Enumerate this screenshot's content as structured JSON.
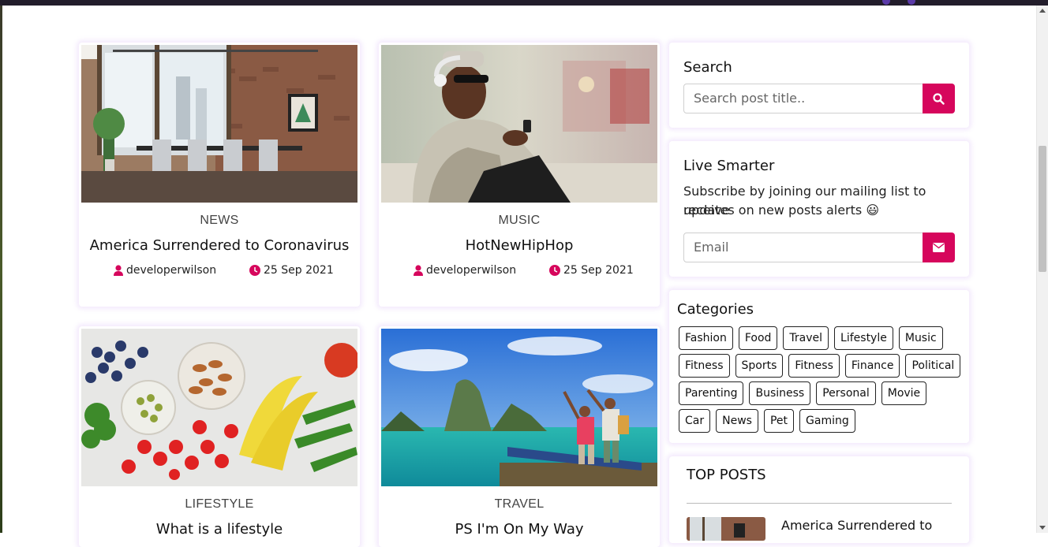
{
  "colors": {
    "accent": "#d6065c",
    "shadow": "#c8a0f0"
  },
  "posts": [
    {
      "category": "NEWS",
      "title": "America Surrendered to Coronavirus",
      "author": "developerwilson",
      "date": "25 Sep 2021",
      "image": "dining-room"
    },
    {
      "category": "MUSIC",
      "title": "HotNewHipHop",
      "author": "developerwilson",
      "date": "25 Sep 2021",
      "image": "man-with-headphones"
    },
    {
      "category": "LIFESTYLE",
      "title": "What is a lifestyle",
      "image": "fruits-and-vegetables"
    },
    {
      "category": "TRAVEL",
      "title": "PS I'm On My Way",
      "image": "tropical-beach-travelers"
    }
  ],
  "search": {
    "title": "Search",
    "placeholder": "Search post title..",
    "icon": "search-icon"
  },
  "newsletter": {
    "title": "Live Smarter",
    "text_line1": "Subscribe by joining our mailing list to receive",
    "text_line2": "updates on new posts alerts 😃",
    "placeholder": "Email",
    "icon": "envelope-icon"
  },
  "categories": {
    "title": "Categories",
    "items": [
      "Fashion",
      "Food",
      "Travel",
      "Lifestyle",
      "Music",
      "Fitness",
      "Sports",
      "Fitness",
      "Finance",
      "Political",
      "Parenting",
      "Business",
      "Personal",
      "Movie",
      "Car",
      "News",
      "Pet",
      "Gaming"
    ]
  },
  "top_posts": {
    "title": "TOP POSTS",
    "items": [
      {
        "title": "America Surrendered to"
      }
    ]
  }
}
